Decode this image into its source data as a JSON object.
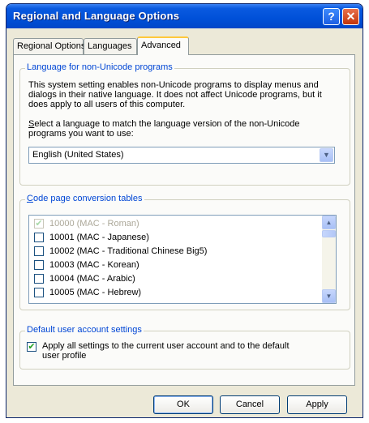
{
  "window": {
    "title": "Regional and Language Options",
    "help_label": "?",
    "close_label": "✕"
  },
  "tabs": [
    {
      "label": "Regional Options"
    },
    {
      "label": "Languages"
    },
    {
      "label": "Advanced"
    }
  ],
  "language_group": {
    "title": "Language for non-Unicode programs",
    "description": "This system setting enables non-Unicode programs to display menus and dialogs in their native language. It does not affect Unicode programs, but it does apply to all users of this computer.",
    "select_label_first": "S",
    "select_label_rest": "elect a language to match the language version of the non-Unicode programs you want to use:",
    "selected_value": "English (United States)"
  },
  "codepage_group": {
    "title_first": "C",
    "title_rest": "ode page conversion tables",
    "items": [
      {
        "label": "10000 (MAC - Roman)",
        "checked": true,
        "disabled": true
      },
      {
        "label": "10001 (MAC - Japanese)",
        "checked": false,
        "disabled": false
      },
      {
        "label": "10002 (MAC - Traditional Chinese Big5)",
        "checked": false,
        "disabled": false
      },
      {
        "label": "10003 (MAC - Korean)",
        "checked": false,
        "disabled": false
      },
      {
        "label": "10004 (MAC - Arabic)",
        "checked": false,
        "disabled": false
      },
      {
        "label": "10005 (MAC - Hebrew)",
        "checked": false,
        "disabled": false
      }
    ]
  },
  "default_group": {
    "title": "Default user account settings",
    "checkbox_label": "Apply all settings to the current user account and to the default user profile",
    "checked": true
  },
  "buttons": {
    "ok": "OK",
    "cancel": "Cancel",
    "apply": "Apply"
  }
}
